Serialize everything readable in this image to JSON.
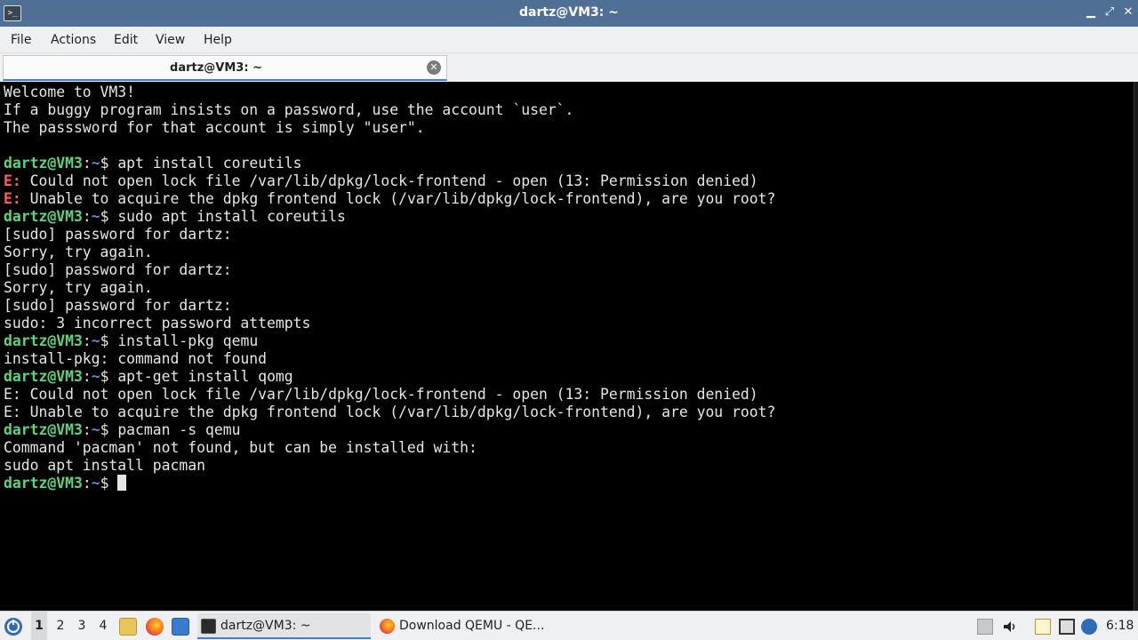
{
  "window": {
    "title": "dartz@VM3: ~",
    "app_icon": "terminal-icon",
    "controls": {
      "minimize": "▁",
      "maximize": "⤢",
      "close": "✕"
    }
  },
  "menu": {
    "items": [
      "File",
      "Actions",
      "Edit",
      "View",
      "Help"
    ]
  },
  "tab": {
    "title": "dartz@VM3: ~",
    "close_icon": "✕"
  },
  "terminal": {
    "prompt_user": "dartz@VM3",
    "prompt_sep": ":",
    "prompt_path": "~",
    "prompt_dollar": "$ ",
    "lines": [
      {
        "type": "text",
        "text": "Welcome to VM3!"
      },
      {
        "type": "text",
        "text": "If a buggy program insists on a password, use the account `user`."
      },
      {
        "type": "text",
        "text": "The passsword for that account is simply \"user\"."
      },
      {
        "type": "text",
        "text": ""
      },
      {
        "type": "prompt",
        "text": "apt install coreutils"
      },
      {
        "type": "error",
        "tag": "E:",
        "text": " Could not open lock file /var/lib/dpkg/lock-frontend - open (13: Permission denied)"
      },
      {
        "type": "error",
        "tag": "E:",
        "text": " Unable to acquire the dpkg frontend lock (/var/lib/dpkg/lock-frontend), are you root?"
      },
      {
        "type": "prompt",
        "text": "sudo apt install coreutils"
      },
      {
        "type": "text",
        "text": "[sudo] password for dartz:"
      },
      {
        "type": "text",
        "text": "Sorry, try again."
      },
      {
        "type": "text",
        "text": "[sudo] password for dartz:"
      },
      {
        "type": "text",
        "text": "Sorry, try again."
      },
      {
        "type": "text",
        "text": "[sudo] password for dartz:"
      },
      {
        "type": "text",
        "text": "sudo: 3 incorrect password attempts"
      },
      {
        "type": "prompt",
        "text": "install-pkg qemu"
      },
      {
        "type": "text",
        "text": "install-pkg: command not found"
      },
      {
        "type": "prompt",
        "text": "apt-get install qomg"
      },
      {
        "type": "text",
        "text": "E: Could not open lock file /var/lib/dpkg/lock-frontend - open (13: Permission denied)"
      },
      {
        "type": "text",
        "text": "E: Unable to acquire the dpkg frontend lock (/var/lib/dpkg/lock-frontend), are you root?"
      },
      {
        "type": "prompt",
        "text": "pacman -s qemu"
      },
      {
        "type": "text",
        "text": "Command 'pacman' not found, but can be installed with:"
      },
      {
        "type": "text",
        "text": "sudo apt install pacman"
      },
      {
        "type": "cursor",
        "text": ""
      }
    ]
  },
  "taskbar": {
    "start_icon": "start-menu-icon",
    "desktops": [
      "1",
      "2",
      "3",
      "4"
    ],
    "active_desktop": "1",
    "launchers": [
      "file-manager-icon",
      "firefox-icon",
      "desktop-icon"
    ],
    "tasks": [
      {
        "label": "dartz@VM3: ~",
        "icon": "terminal-icon",
        "active": true
      },
      {
        "label": "Download QEMU - QE...",
        "icon": "firefox-icon",
        "active": false
      }
    ],
    "tray": [
      "notification-icon",
      "volume-icon",
      "clipboard-icon",
      "display-icon",
      "network-icon"
    ],
    "clock": "6:18"
  },
  "colors": {
    "titlebar": "#4f6f95",
    "terminal_bg": "#000000",
    "prompt_user": "#5dd57a",
    "prompt_path": "#5b8dd9",
    "error_tag": "#ff5c5c",
    "accent": "#3d7fd4"
  }
}
